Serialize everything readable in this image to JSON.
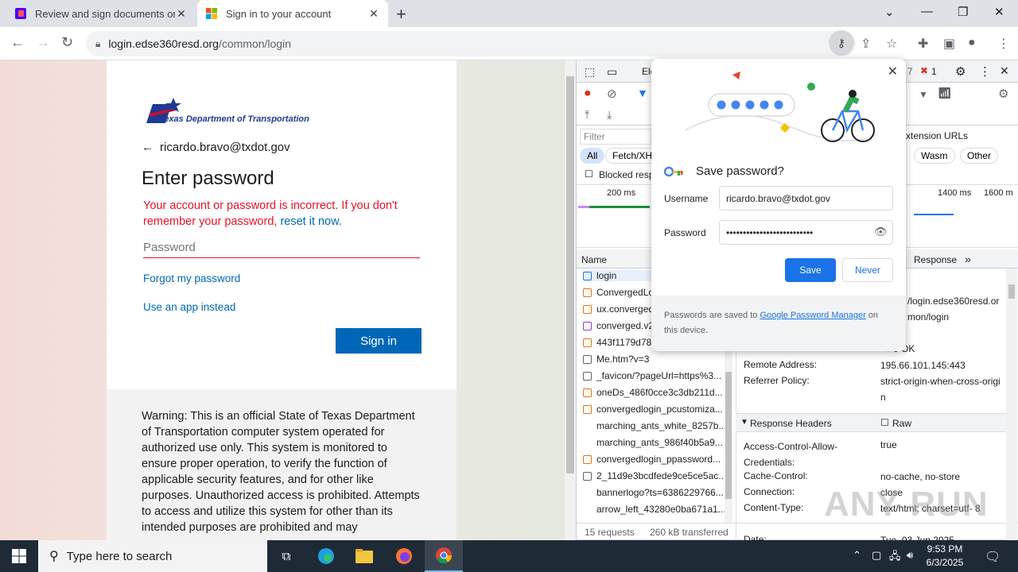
{
  "tabs": [
    {
      "title": "Review and sign documents on D",
      "favicon_color": "#e8330f"
    },
    {
      "title": "Sign in to your account",
      "active": true
    }
  ],
  "address_bar": {
    "host": "login.edse360resd.org",
    "path": "/common/login"
  },
  "signin_page": {
    "logo_text": "Texas Department of Transportation",
    "account": "ricardo.bravo@txdot.gov",
    "heading": "Enter password",
    "error_text": "Your account or password is incorrect. If you don't remember your password, ",
    "error_link": "reset it now.",
    "password_placeholder": "Password",
    "forgot_link": "Forgot my password",
    "app_link": "Use an app instead",
    "signin_button": "Sign in",
    "warning": "Warning: This is an official State of Texas Department of Transportation computer system operated for authorized use only. This system is monitored to ensure proper operation, to verify the function of applicable security features, and for other like purposes. Unauthorized access is prohibited. Attempts to access and utilize this system for other than its intended purposes are prohibited and may"
  },
  "devtools": {
    "tab_elements": "Ele",
    "filter_placeholder": "Filter",
    "chips": [
      "All",
      "Fetch/XH",
      "Wasm",
      "Other"
    ],
    "blocked": "Blocked resp",
    "extension_urls": "xtension URLs",
    "timeline": [
      "200 ms",
      "1400 ms",
      "1600 m"
    ],
    "name_col": "Name",
    "response_tab": "Response",
    "requests": [
      "login",
      "ConvergedLo",
      "ux.converged",
      "converged.v2",
      "443f1179d78",
      "Me.htm?v=3",
      "_favicon/?pageUrl=https%3...",
      "oneDs_486f0cce3c3db211d...",
      "convergedlogin_pcustomiza...",
      "marching_ants_white_8257b...",
      "marching_ants_986f40b5a9...",
      "convergedlogin_ppassword...",
      "2_11d9e3bcdfede9ce5ce5ac...",
      "bannerlogo?ts=6386229766...",
      "arrow_left_43280e0ba671a1..."
    ],
    "status_summary": "15 requests",
    "transferred": "260 kB transferred",
    "request_url_line1": "/login.edse360resd.or",
    "request_url_line2": "mon/login",
    "status_code": "0 OK",
    "issues_count": "7",
    "errors_count": "1",
    "general": [
      {
        "k": "Remote Address:",
        "v": "195.66.101.145:443"
      },
      {
        "k": "Referrer Policy:",
        "v": "strict-origin-when-cross-origi n"
      }
    ],
    "response_headers_title": "Response Headers",
    "raw_label": "Raw",
    "response_headers": [
      {
        "k": "Access-Control-Allow- Credentials:",
        "v": "true"
      },
      {
        "k": "Cache-Control:",
        "v": "no-cache, no-store"
      },
      {
        "k": "Connection:",
        "v": "close"
      },
      {
        "k": "Content-Type:",
        "v": "text/html; charset=utf- 8"
      },
      {
        "k": "Date:",
        "v": "Tue, 03 Jun 2025"
      }
    ]
  },
  "password_popup": {
    "title": "Save password?",
    "username_label": "Username",
    "username_value": "ricardo.bravo@txdot.gov",
    "password_label": "Password",
    "password_value": "••••••••••••••••••••••••••",
    "save": "Save",
    "never": "Never",
    "footer_text": "Passwords are saved to ",
    "footer_link": "Google Password Manager",
    "footer_tail": " on this device."
  },
  "taskbar": {
    "search_placeholder": "Type here to search",
    "time": "9:53 PM",
    "date": "6/3/2025"
  },
  "watermark": "ANY RUN",
  "colors": {
    "accent": "#1a73e8",
    "error": "#e81123",
    "ms_blue": "#0067b8"
  }
}
